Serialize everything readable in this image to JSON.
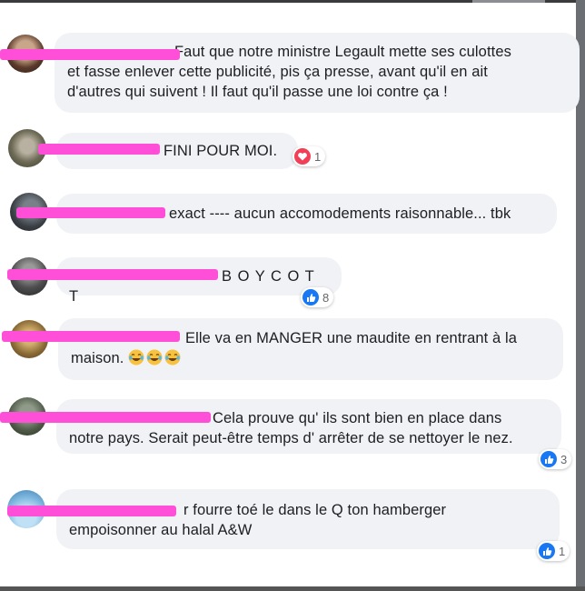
{
  "comments": [
    {
      "text": "Faut que notre ministre Legault mette ses culottes",
      "text2": "et fasse enlever cette publicité, pis ça presse, avant qu'il en ait",
      "text3": "d'autres qui suivent ! Il faut qu'il passe une loi contre ça !"
    },
    {
      "text": "FINI POUR MOI.",
      "reaction": {
        "type": "love",
        "count": "1"
      }
    },
    {
      "text": "exact ---- aucun accomodements raisonnable... tbk"
    },
    {
      "text": "B O Y C O T T",
      "reaction": {
        "type": "like",
        "count": "8"
      }
    },
    {
      "text": "Elle va en MANGER une maudite en rentrant à la",
      "text2": "maison.",
      "emoji": [
        "tears-of-joy",
        "tears-of-joy",
        "tears-of-joy"
      ]
    },
    {
      "text": "Cela prouve qu' ils sont bien en place dans",
      "text2": "notre pays. Serait peut-être temps d' arrêter de se nettoyer le nez.",
      "reaction": {
        "type": "like",
        "count": "3"
      }
    },
    {
      "text": "r fourre toé le dans le Q ton hamberger",
      "text2": "empoisonner au halal A&W",
      "reaction": {
        "type": "like",
        "count": "1"
      }
    }
  ],
  "colors": {
    "bubble": "#f0f2f5",
    "name": "#385898",
    "redaction": "#ff4fd8",
    "like": "#1877f2",
    "love": "#f33e58"
  }
}
